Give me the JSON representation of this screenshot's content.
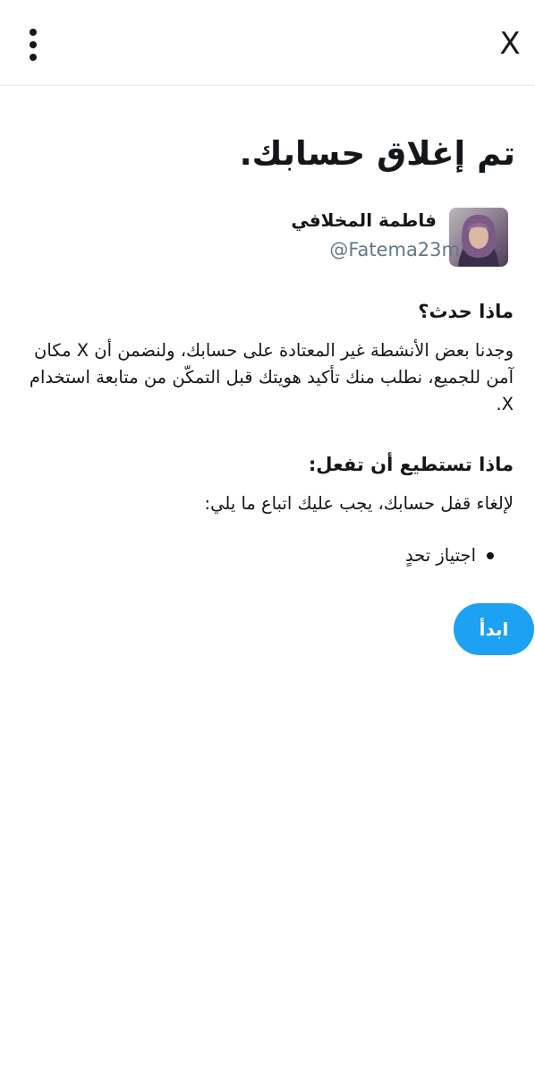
{
  "header": {
    "close_label": "X",
    "more_icon": "vertical-ellipsis-icon"
  },
  "page": {
    "title": "تم إغلاق حسابك."
  },
  "profile": {
    "name": "فاطمة المخلافي",
    "handle": "@Fatema23m"
  },
  "what_happened": {
    "heading": "ماذا حدث؟",
    "body": "وجدنا بعض الأنشطة غير المعتادة على حسابك، ولنضمن أن X مكان آمن للجميع، نطلب منك تأكيد هويتك قبل التمكّن من متابعة استخدام X."
  },
  "what_you_can_do": {
    "heading": "ماذا تستطيع أن تفعل:",
    "body": "لإلغاء قفل حسابك، يجب عليك اتباع ما يلي:",
    "steps": [
      "اجتياز تحدٍ"
    ]
  },
  "actions": {
    "start_label": "ابدأ"
  },
  "colors": {
    "accent": "#1da1f2",
    "text": "#14171a",
    "secondary_text": "#657786",
    "divider": "#e6ecf0"
  }
}
